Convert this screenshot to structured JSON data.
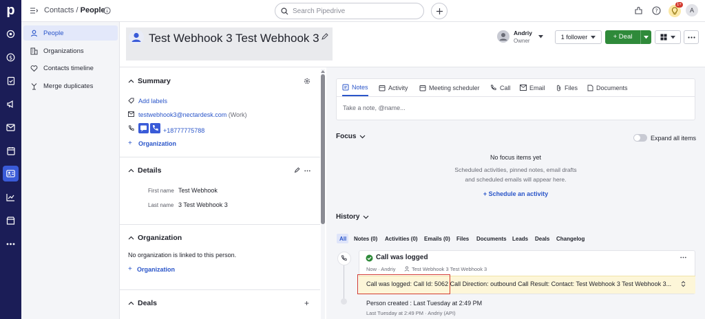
{
  "brand": {
    "logo_letter": "p"
  },
  "breadcrumb": {
    "parent": "Contacts",
    "separator": "/",
    "current": "People"
  },
  "search": {
    "placeholder": "Search Pipedrive"
  },
  "topbar": {
    "notification_badge": "1+",
    "avatar_initial": "A"
  },
  "subnav": {
    "items": [
      {
        "label": "People",
        "icon": "person-icon",
        "active": true
      },
      {
        "label": "Organizations",
        "icon": "building-icon",
        "active": false
      },
      {
        "label": "Contacts timeline",
        "icon": "heart-handshake-icon",
        "active": false
      },
      {
        "label": "Merge duplicates",
        "icon": "merge-icon",
        "active": false
      }
    ]
  },
  "header": {
    "person_name": "Test Webhook 3 Test Webhook 3",
    "owner_name": "Andriy",
    "owner_role": "Owner",
    "follower_label": "1 follower",
    "deal_label": "+ Deal"
  },
  "summary": {
    "title": "Summary",
    "add_labels": "Add labels",
    "email": "testwebhook3@nectardesk.com",
    "email_type": "(Work)",
    "phone": "+18777775788",
    "add_org": "Organization"
  },
  "details": {
    "title": "Details",
    "fields": [
      {
        "label": "First name",
        "value": "Test Webhook"
      },
      {
        "label": "Last name",
        "value": "3 Test Webhook 3"
      }
    ]
  },
  "organization": {
    "title": "Organization",
    "empty_text": "No organization is linked to this person.",
    "add_label": "Organization"
  },
  "deals": {
    "title": "Deals"
  },
  "composer": {
    "tabs": [
      "Notes",
      "Activity",
      "Meeting scheduler",
      "Call",
      "Email",
      "Files",
      "Documents"
    ],
    "placeholder": "Take a note, @name..."
  },
  "focus": {
    "title": "Focus",
    "expand_label": "Expand all items",
    "empty_title": "No focus items yet",
    "empty_line1": "Scheduled activities, pinned notes, email drafts",
    "empty_line2": "and scheduled emails will appear here.",
    "schedule_link": "+ Schedule an activity"
  },
  "history": {
    "title": "History",
    "filters": [
      "All",
      "Notes (0)",
      "Activities (0)",
      "Emails (0)",
      "Files",
      "Documents",
      "Leads",
      "Deals",
      "Changelog"
    ],
    "call": {
      "title": "Call was logged",
      "meta_time": "Now · Andriy",
      "meta_person": "Test Webhook 3 Test Webhook 3",
      "note": "Call was logged: Call Id: 5062 Call Direction: outbound Call Result: Contact: Test Webhook 3 Test Webhook 3..."
    },
    "created": {
      "title": "Person created : Last Tuesday at 2:49 PM",
      "meta": "Last Tuesday at 2:49 PM · Andriy (API)"
    }
  },
  "colors": {
    "rail": "#1b1d57",
    "accent": "#2a55c9",
    "deal_green": "#2f8a3a",
    "highlight": "#d33a2f"
  }
}
